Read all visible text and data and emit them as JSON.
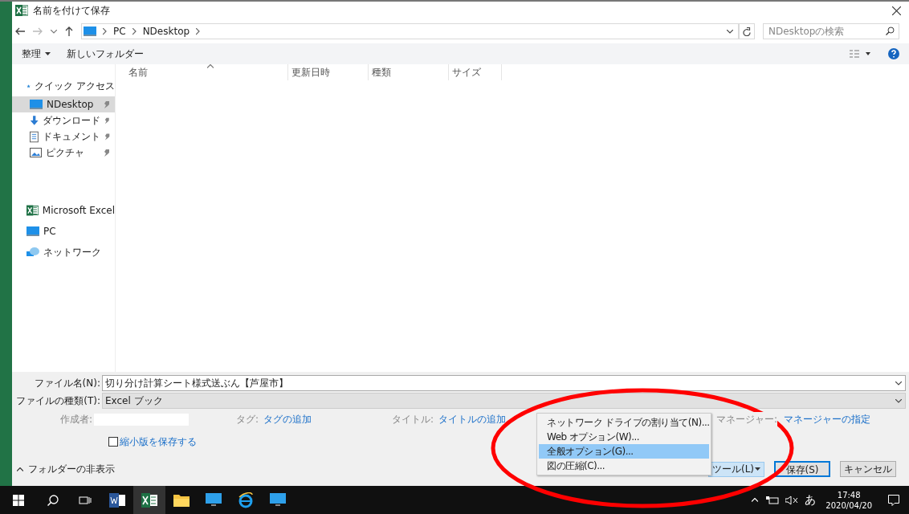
{
  "window": {
    "title": "名前を付けて保存"
  },
  "address": {
    "path": [
      "PC",
      "NDesktop"
    ],
    "search_placeholder": "NDesktopの検索"
  },
  "toolbar": {
    "organize": "整理",
    "new_folder": "新しいフォルダー"
  },
  "columns": [
    "名前",
    "更新日時",
    "種類",
    "サイズ"
  ],
  "sidebar": {
    "groups": [
      {
        "label": "クイック アクセス",
        "items": [
          {
            "label": "NDesktop",
            "selected": true
          },
          {
            "label": "ダウンロード",
            "selected": false
          },
          {
            "label": "ドキュメント",
            "selected": false
          },
          {
            "label": "ピクチャ",
            "selected": false
          }
        ]
      },
      {
        "label": "Microsoft Excel"
      },
      {
        "label": "PC"
      },
      {
        "label": "ネットワーク"
      }
    ]
  },
  "form": {
    "filename_label": "ファイル名(N):",
    "filename": "切り分け計算シート様式送ぶん【芦屋市】",
    "filetype_label": "ファイルの種類(T):",
    "filetype": "Excel ブック",
    "author_label": "作成者:",
    "tags_label": "タグ:",
    "tags_value": "タグの追加",
    "title_label": "タイトル:",
    "title_value": "タイトルの追加",
    "manager_label": "マネージャー:",
    "manager_value": "マネージャーの指定",
    "thumbnail": {
      "label": "縮小版を保存する",
      "checked": false
    }
  },
  "hide_folders": "フォルダーの非表示",
  "buttons": {
    "tools": "ツール(L)",
    "save": "保存(S)",
    "cancel": "キャンセル"
  },
  "menu": [
    {
      "label": "ネットワーク ドライブの割り当て(N)...",
      "selected": false
    },
    {
      "label": "Web オプション(W)...",
      "selected": false
    },
    {
      "label": "全般オプション(G)...",
      "selected": true
    },
    {
      "label": "図の圧縮(C)...",
      "selected": false
    }
  ],
  "taskbar": {
    "apps": [
      {
        "active": false
      },
      {
        "active": true
      },
      {
        "active": false
      },
      {
        "active": false
      },
      {
        "active": false
      },
      {
        "active": false
      }
    ],
    "ime": "あ",
    "time": "17:48",
    "date": "2020/04/20"
  }
}
